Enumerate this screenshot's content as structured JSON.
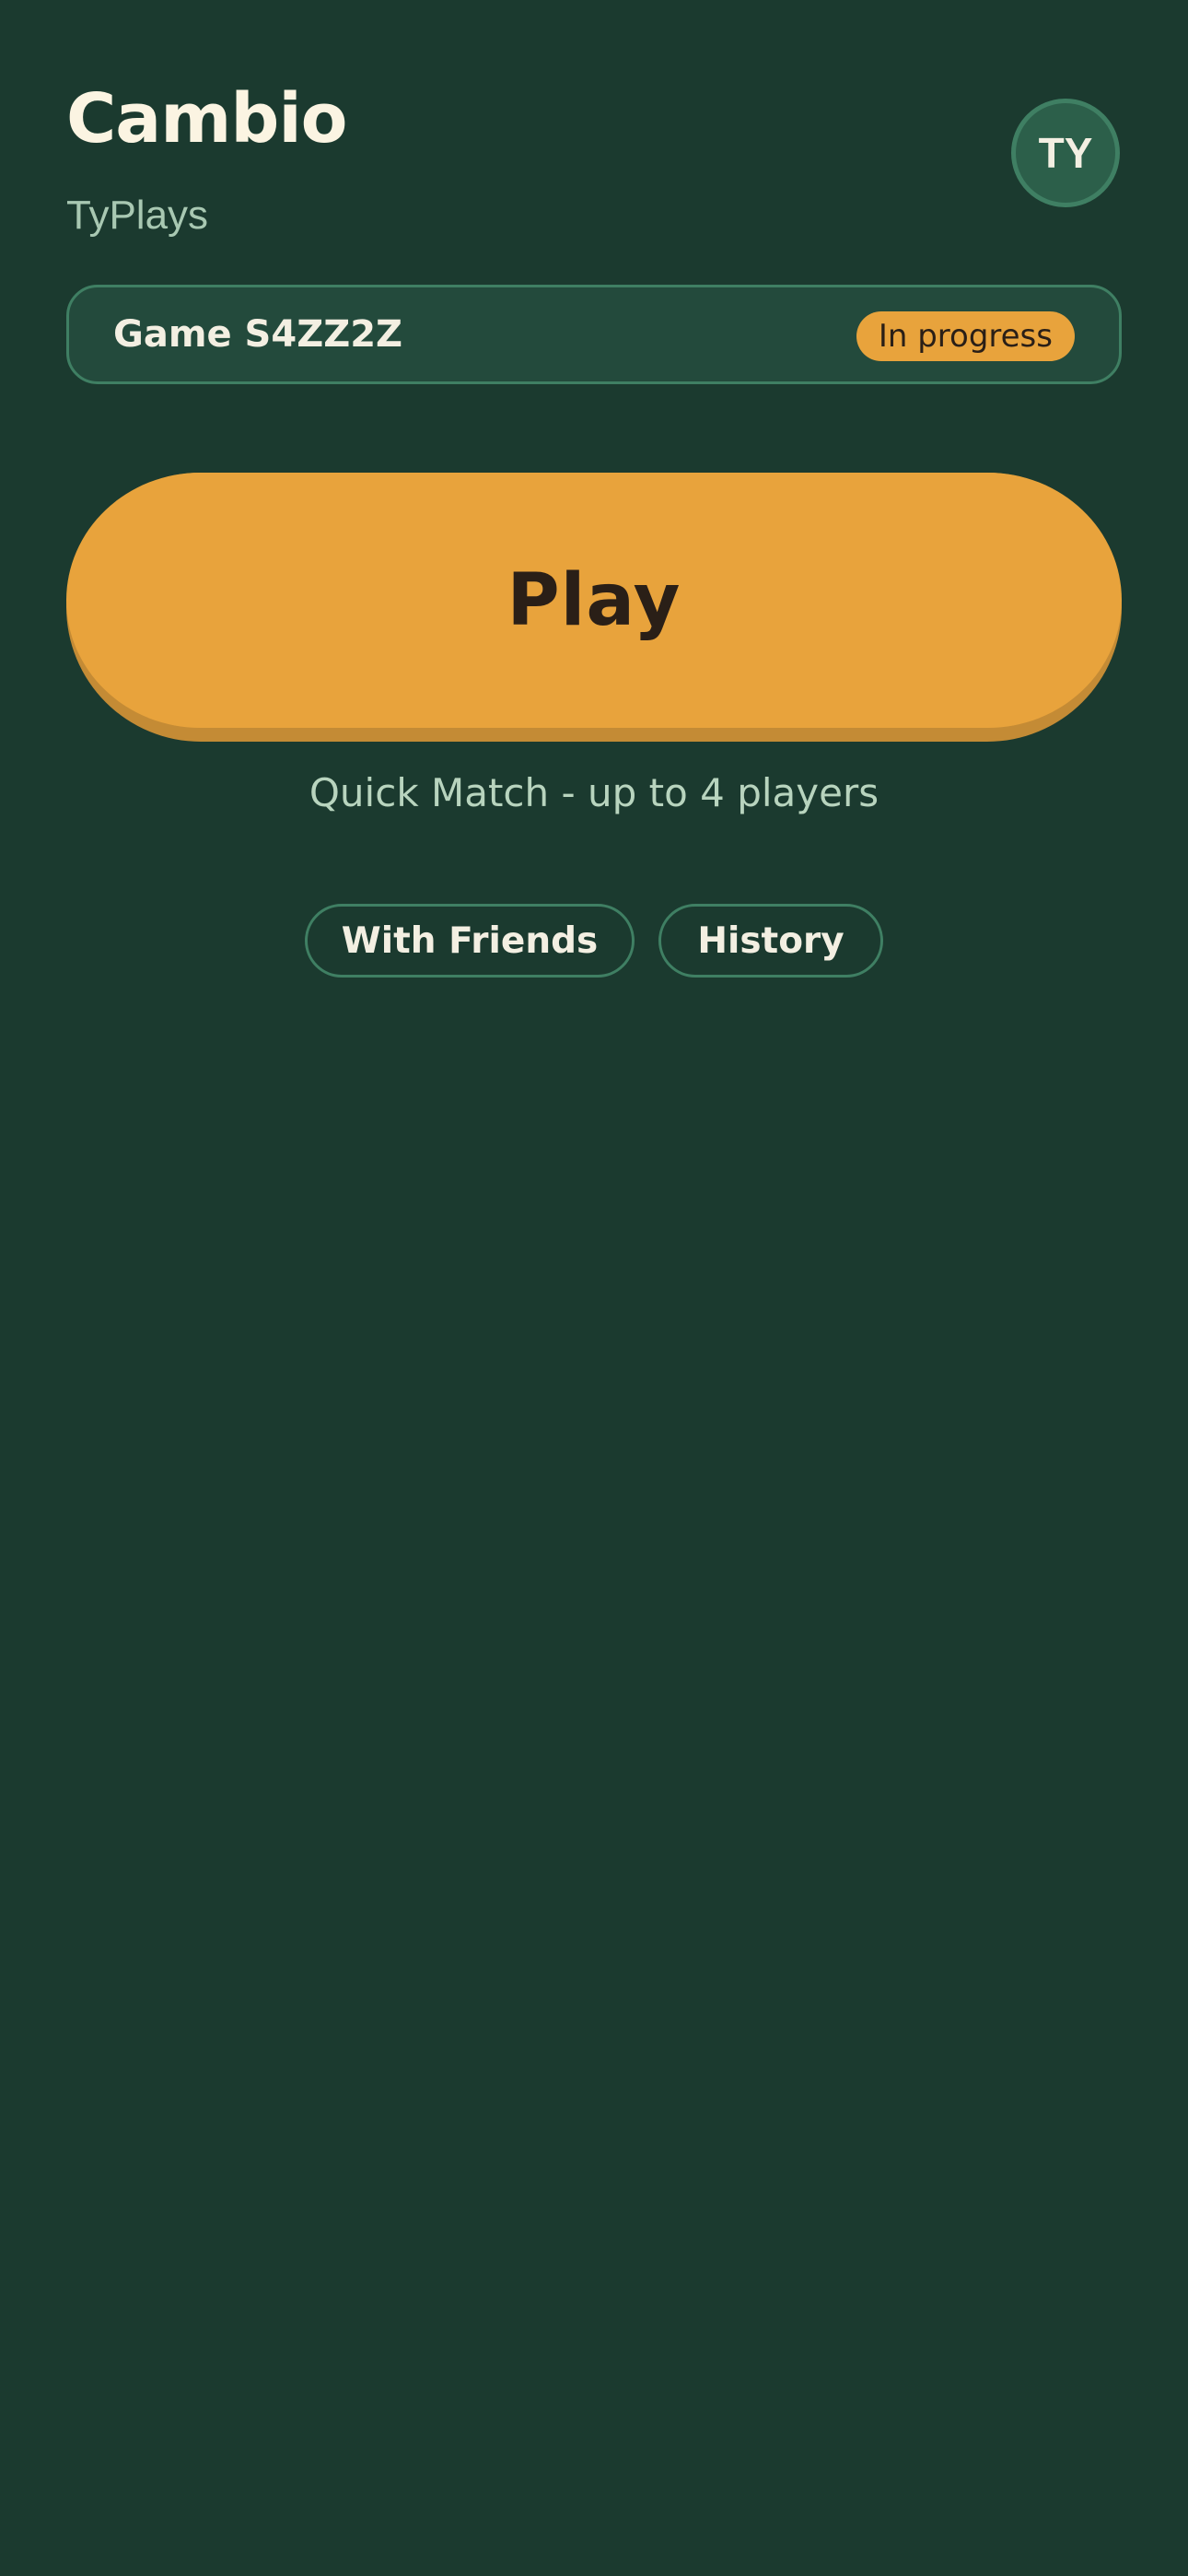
{
  "header": {
    "title": "Cambio",
    "username": "TyPlays",
    "avatar_initials": "TY"
  },
  "current_game": {
    "label": "Game S4ZZ2Z",
    "status": "In progress"
  },
  "play": {
    "label": "Play",
    "subtitle": "Quick Match - up to 4 players"
  },
  "actions": {
    "friends_label": "With Friends",
    "history_label": "History"
  },
  "colors": {
    "background": "#1b3a2f",
    "accent": "#e8a33c",
    "card": "#234a3c",
    "border": "#3f7f63",
    "title": "#fbf4e2",
    "muted_text": "#a8c8b2"
  }
}
